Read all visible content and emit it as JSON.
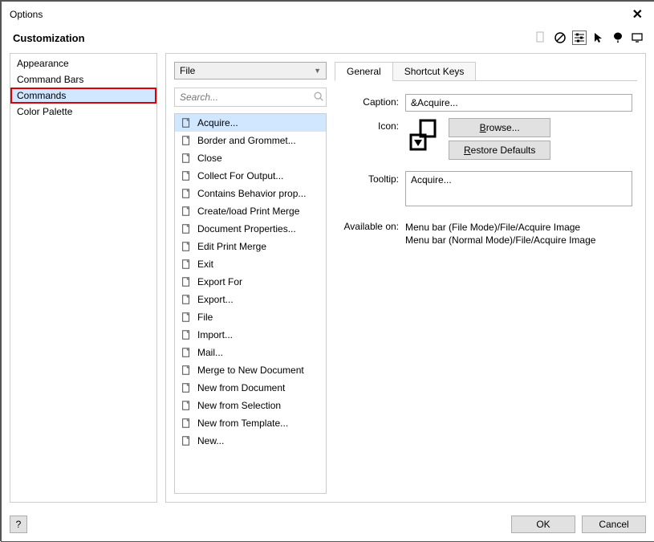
{
  "window": {
    "title": "Options"
  },
  "header": {
    "label": "Customization"
  },
  "sidebar": {
    "items": [
      "Appearance",
      "Command Bars",
      "Commands",
      "Color Palette"
    ],
    "selected": 2
  },
  "category_combo": {
    "value": "File"
  },
  "search": {
    "placeholder": "Search..."
  },
  "commands": [
    {
      "label": "Acquire...",
      "selected": true
    },
    {
      "label": "Border and Grommet..."
    },
    {
      "label": "Close"
    },
    {
      "label": "Collect For Output..."
    },
    {
      "label": "Contains Behavior prop..."
    },
    {
      "label": "Create/load Print Merge"
    },
    {
      "label": "Document Properties..."
    },
    {
      "label": "Edit Print Merge"
    },
    {
      "label": "Exit"
    },
    {
      "label": "Export For"
    },
    {
      "label": "Export..."
    },
    {
      "label": "File"
    },
    {
      "label": "Import..."
    },
    {
      "label": "Mail..."
    },
    {
      "label": "Merge to New Document"
    },
    {
      "label": "New from Document"
    },
    {
      "label": "New from Selection"
    },
    {
      "label": "New from Template..."
    },
    {
      "label": "New..."
    }
  ],
  "tabs": {
    "items": [
      "General",
      "Shortcut Keys"
    ],
    "active": 0
  },
  "details": {
    "caption_label": "Caption:",
    "caption_value": "&Acquire...",
    "icon_label": "Icon:",
    "browse_btn": "Browse...",
    "restore_btn": "Restore Defaults",
    "tooltip_label": "Tooltip:",
    "tooltip_value": "Acquire...",
    "available_label": "Available on:",
    "available_lines": [
      "Menu bar (File Mode)/File/Acquire Image",
      "Menu bar (Normal Mode)/File/Acquire Image"
    ]
  },
  "footer": {
    "help": "?",
    "ok": "OK",
    "cancel": "Cancel"
  }
}
